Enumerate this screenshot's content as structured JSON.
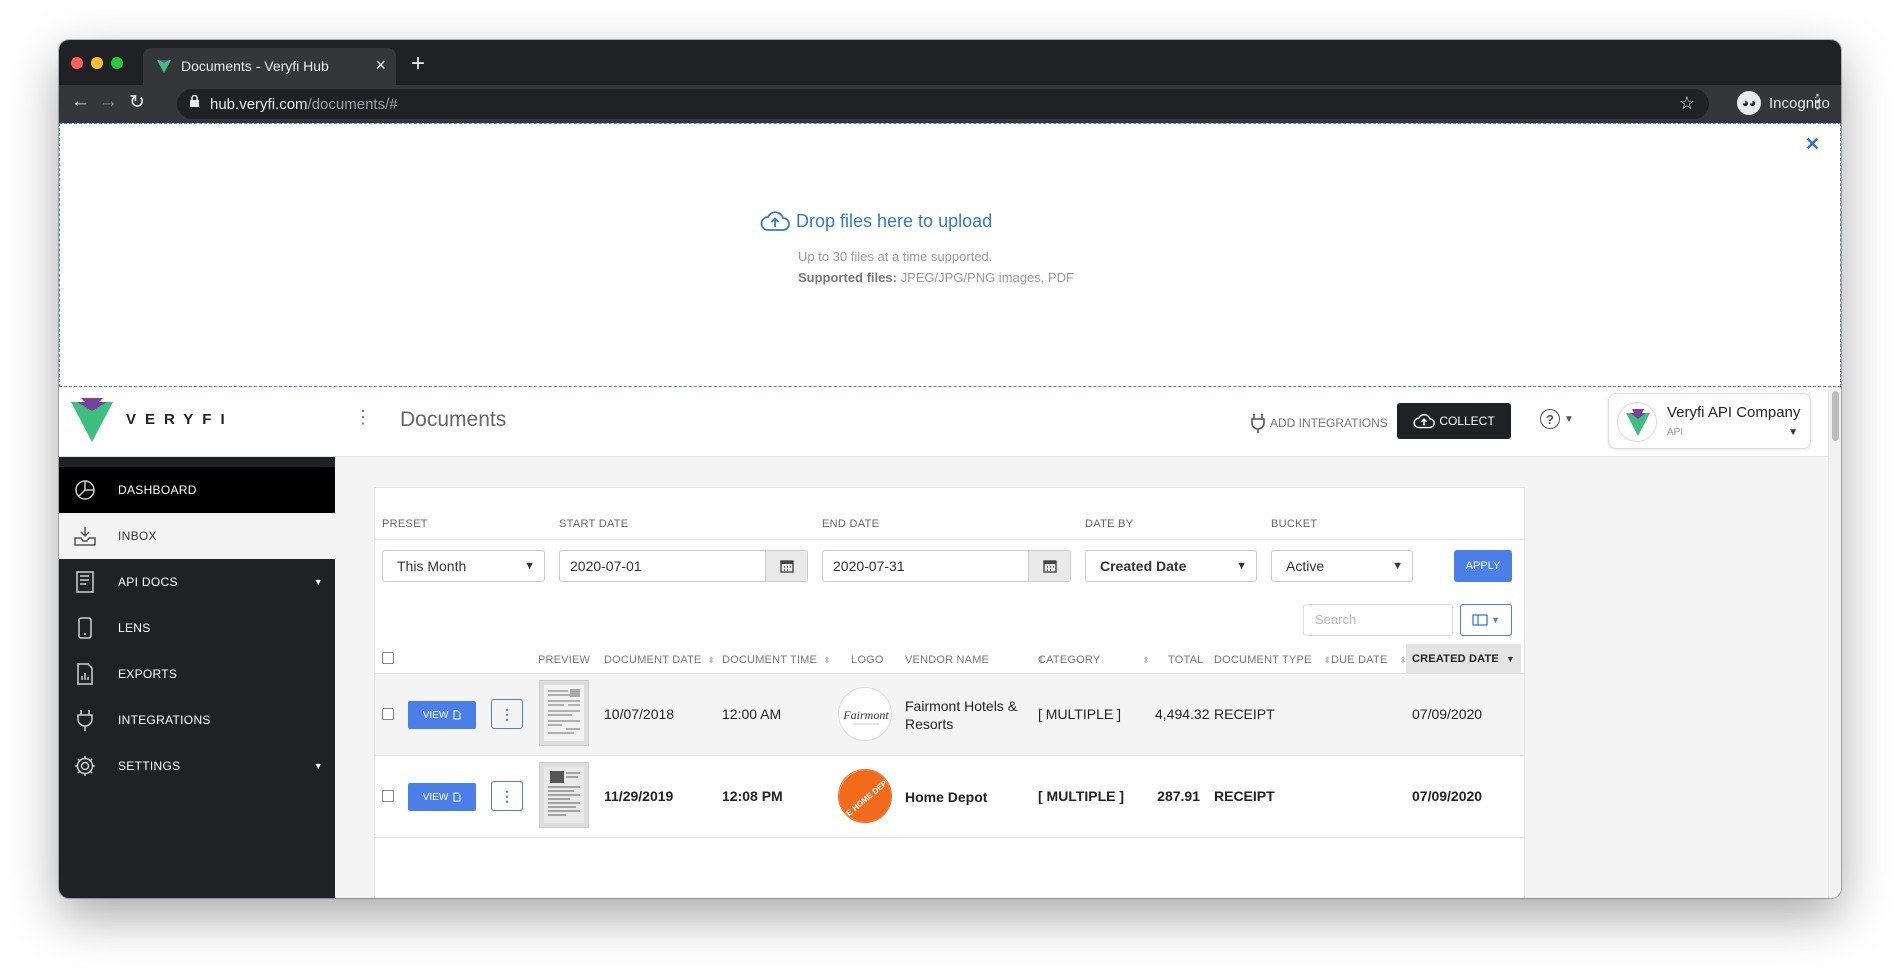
{
  "browser": {
    "tab_title": "Documents - Veryfi Hub",
    "url_host": "hub.veryfi.com",
    "url_path": "/documents/#",
    "incognito_label": "Incognito"
  },
  "upload": {
    "title": "Drop files here to upload",
    "line1": "Up to 30 files at a time supported.",
    "supported_label": "Supported files:",
    "supported_value": " JPEG/JPG/PNG images, PDF"
  },
  "header": {
    "brand": "VERYFI",
    "page_title": "Documents",
    "add_integrations": "ADD INTEGRATIONS",
    "collect": "COLLECT",
    "company_name": "Veryfi API Company",
    "company_role": "API"
  },
  "sidebar": {
    "items": [
      {
        "label": "DASHBOARD"
      },
      {
        "label": "INBOX"
      },
      {
        "label": "API DOCS"
      },
      {
        "label": "LENS"
      },
      {
        "label": "EXPORTS"
      },
      {
        "label": "INTEGRATIONS"
      },
      {
        "label": "SETTINGS"
      }
    ]
  },
  "filters": {
    "preset_label": "PRESET",
    "preset_value": "This Month",
    "start_label": "START DATE",
    "start_value": "2020-07-01",
    "end_label": "END DATE",
    "end_value": "2020-07-31",
    "dateby_label": "DATE BY",
    "dateby_value": "Created Date",
    "bucket_label": "BUCKET",
    "bucket_value": "Active",
    "apply": "APPLY",
    "search_placeholder": "Search"
  },
  "table": {
    "headers": {
      "preview": "PREVIEW",
      "document_date": "DOCUMENT DATE",
      "document_time": "DOCUMENT TIME",
      "logo": "LOGO",
      "vendor_name": "VENDOR NAME",
      "category": "CATEGORY",
      "total": "TOTAL",
      "document_type": "DOCUMENT TYPE",
      "due_date": "DUE DATE",
      "created_date": "CREATED DATE"
    },
    "view_label": "VIEW",
    "rows": [
      {
        "document_date": "10/07/2018",
        "document_time": "12:00 AM",
        "logo_text": "Fairmont",
        "vendor_line1": "Fairmont Hotels &",
        "vendor_line2": "Resorts",
        "category": "[ MULTIPLE ]",
        "total": "4,494.32",
        "document_type": "RECEIPT",
        "due_date": "",
        "created_date": "07/09/2020"
      },
      {
        "document_date": "11/29/2019",
        "document_time": "12:08 PM",
        "logo_text": "THE HOME DEPOT",
        "vendor_line1": "Home Depot",
        "vendor_line2": "",
        "category": "[ MULTIPLE ]",
        "total": "287.91",
        "document_type": "RECEIPT",
        "due_date": "",
        "created_date": "07/09/2020"
      }
    ]
  },
  "colors": {
    "accent_blue": "#4a7fe8",
    "sidebar_bg": "#202124",
    "brand_green": "#3fbf7f",
    "brand_purple": "#7b3fa0",
    "homedepot_orange": "#f26b1d"
  },
  "icons": [
    "veryfi-logo-icon",
    "lock-icon",
    "star-icon",
    "incognito-icon",
    "cloud-upload-icon",
    "plug-icon",
    "help-icon",
    "calendar-icon",
    "columns-icon",
    "dashboard-icon",
    "inbox-icon",
    "book-icon",
    "phone-icon",
    "export-icon",
    "gear-icon",
    "file-icon"
  ]
}
